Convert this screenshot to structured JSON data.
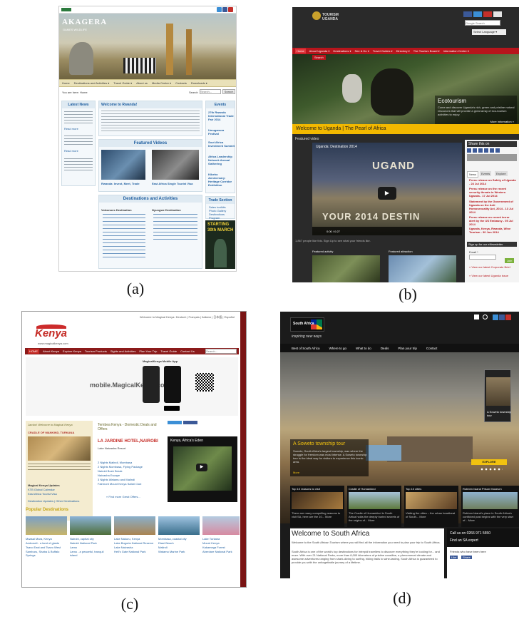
{
  "captions": {
    "a": "(a)",
    "b": "(b)",
    "c": "(c)",
    "d": "(d)"
  },
  "panel_a": {
    "brand": "AKAGERA",
    "brand_sub": "GAMES WILDLIFE",
    "nav": [
      "Home",
      "Destinations and Activities ▾",
      "Travel Guide ▾",
      "About us",
      "Media Center ▾",
      "Contacts",
      "Downloads ▾"
    ],
    "you_are_here": "You are here: Home",
    "search_label": "Search",
    "search_placeholder": "Search...",
    "search_button": "Search",
    "latest_news": "Latest News",
    "welcome_title": "Welcome to Rwanda!",
    "featured_videos": "Featured Videos",
    "video_captions": [
      "Rwanda: Invest, Meet, Trade",
      "East Africa Single Tourist Visa"
    ],
    "destinations_title": "Destinations and Activities",
    "volcanoes_title": "Volcanoes Destination",
    "nyungwe_title": "Nyungwe Destination",
    "events_title": "Events",
    "events": [
      "27th Rwanda International Trade Fair 2014",
      "Umuganura Festival",
      "Sout Africa Investment Summit",
      "Africa Leadership Network Annual Gathering",
      "Kibeho Anniversary: Heritage Corridor Exhibition"
    ],
    "trade_title": "Trade Section",
    "trade_items": [
      "Sales toolkits",
      "Photo Gallery",
      "Destinations Program"
    ],
    "ad_text": [
      "STARTING",
      "30th MARCH"
    ],
    "read_more": "Read more"
  },
  "panel_b": {
    "logo": "TOURISM UGANDA",
    "search_placeholder": "Google Search",
    "language": "Select Language ▾",
    "nav": [
      "Home",
      "About Uganda ▾",
      "Destinations ▾",
      "See & Do ▾",
      "Travel Guides ▾",
      "Directory ▾",
      "The Tourism Board ▾",
      "Information Centre ▾"
    ],
    "nav2": "Search",
    "hero_title": "Ecotourism",
    "hero_text": "Come and discover Uganda's rich, green and pristine natural resources that will provide a great array of eco-tourism activities to enjoy.",
    "hero_more": "More information »",
    "welcome_banner": "Welcome to Uganda | The Pearl of Africa",
    "featured_video": "Featured video",
    "video_title": "Uganda: Destination 2014",
    "video_big": "YOUR 2014 DESTIN",
    "video_uganda": "UGAND",
    "video_time": "0:00 / 0:27",
    "like_text": "1,867 people like this. Sign Up to see what your friends like.",
    "featured_activity": "Featured activity",
    "featured_attraction": "Featured attraction",
    "share_title": "Share this on",
    "tabs": [
      "News",
      "Events",
      "Explore"
    ],
    "news": [
      "Press release on Safety of Uganda - 24 Jul 2014",
      "Press release on the recent security threats in Western Uganda - 17 Jul 2014",
      "Statement by the Government of Uganda on the Anti Homosexuality Act, 2014 - 13 Jul 2014",
      "Press release on recent terror alert by the US Embassy - 05 Jul 2014",
      "Uganda, Kenya, Rwanda, Wine Tourism - 30 Jun 2014"
    ],
    "newsletter": "Sign up for our eNewsletter",
    "email_label": "Email *",
    "join": "Join",
    "links": [
      "» View our latest Corporate Brief",
      "» View our latest Uganda issue"
    ]
  },
  "panel_c": {
    "top_links": "Welcome to Magical Kenya:  Deutsch  |  Français  |  Italiano  |  日本語  |  Español",
    "logo": "Kenya",
    "logo_url": "www.magicalkenya.com",
    "nav": [
      "HOME",
      "About Kenya",
      "Explore Kenya",
      "Tourism Products",
      "Sights and Activities",
      "Plan Your Trip",
      "Travel Guide",
      "Contact Us"
    ],
    "search_placeholder": "Search...",
    "mobile_app_title": "MagicalKenya Mobile App",
    "mobile_text": "mobile.MagicalKenya.com",
    "intro_title": "Jambo! Welcome to Magical Kenya",
    "cradle": "CRADLE OF MANKIND, TURKANA",
    "updates_title": "Magical Kenya Updates",
    "updates": [
      "KTB Global Calendar",
      "East Africa Tourist Visa",
      "Destination Updates | Other Destinations"
    ],
    "deals_title": "Tembea Kenya - Domestic Deals and Offers",
    "deal_hotel": "LA JARDINE HOTEL,NAIROBI",
    "deals": [
      "Lake Naivasha Resort",
      "2 Nights Malindi, Mombasa",
      "2 Nights Mombasa, Flying Package",
      "Nairobi Bush Break",
      "Naivasha Escape",
      "3 Nights Watamu and Malindi",
      "Fairmont Mount Kenya Safari Club"
    ],
    "more_offers": "» Find more Great Offers...",
    "video_title": "Kenya, Africa's Eden",
    "popular_title": "Popular Destinations",
    "popular": [
      [
        "Maasai Mara, Kenya",
        "Amboseli - a land of giants",
        "Tsavo East and Tsavo West",
        "Samburu, Shaba & Buffalo Springs"
      ],
      [
        "Nairobi, capital city",
        "Nairobi National Park",
        "Lamu",
        "Lamu - a peaceful, tranquil island"
      ],
      [
        "Lake Nakuru, Kenya",
        "Lake Bogoria National Reserve",
        "Lake Naivasha",
        "Hell's Gate National Park"
      ],
      [
        "Mombasa, coastal city",
        "Diani Beach",
        "Malindi",
        "Watamu Marine Park"
      ],
      [
        "Lake Turkana",
        "Mount Kenya",
        "Kakamega Forest",
        "Aberdare National Park"
      ]
    ]
  },
  "panel_d": {
    "logo": "South Africa",
    "tagline": "inspiring new ways",
    "nav": [
      "Best of South Africa",
      "Where to go",
      "What to do",
      "Deals",
      "Plan your trip",
      "Contact"
    ],
    "side_card": "A Soweto township tour",
    "hero_title": "A Soweto township tour",
    "hero_text": "Soweto, South Africa's largest township, was where the struggle for freedom was most intense. A Soweto township tour is the ideal way for visitors to experience this iconic area.",
    "hero_more": "More",
    "explore_btn": "EXPLORE",
    "cards": [
      "Top 10 reasons to visit",
      "Cradle of Humankind",
      "Top 10 cities",
      "Robben Island Prison Museum"
    ],
    "card_texts": [
      "There are many compelling reasons to visit SA, here are the 10... More",
      "The Cradle of Humankind in South Africa holds the deeply buried secrets of the origins of... More",
      "Visiting the cities – the urban heartbeat of South... More",
      "Robben Island's place in South Africa's conflicted past begins with the very start of... More"
    ],
    "welcome_title": "Welcome to South Africa",
    "welcome_text": "Welcome to the South African Tourism where you will find all the information you need to plan your trip to South Africa.",
    "body_text": "South Africa is one of the world's top destinations for intrepid travellers to discover everything they're looking for... and more. With over 21 National Parks, more than 8,000 kilometres of pristine coastline, a phenomenal climate and awesome adventures ranging from shark-diving to surfing, hiking trails to wine-tasting, South Africa is guaranteed to provide you with the unforgettable journey of a lifetime.",
    "call": "Call us on 0266 971 5550",
    "expert": "Find an SA expert",
    "friends": "Friends who have been here",
    "like": "Like",
    "share": "Share"
  },
  "colors": {
    "uganda_red": "#b7151c",
    "kenya_red": "#8b1a1a",
    "rwanda_nav": "#e9e1b9",
    "sa_yellow": "#f2c20f"
  }
}
